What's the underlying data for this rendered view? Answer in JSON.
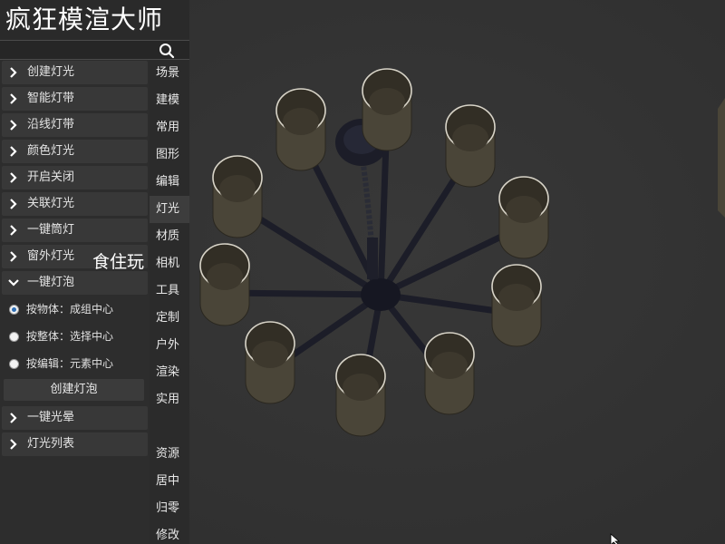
{
  "app": {
    "title": "疯狂模渲大师"
  },
  "search": {
    "icon": "search-icon"
  },
  "menu": {
    "items_top": [
      {
        "label": "创建灯光",
        "expanded": false
      },
      {
        "label": "智能灯带",
        "expanded": false
      },
      {
        "label": "沿线灯带",
        "expanded": false
      },
      {
        "label": "颜色灯光",
        "expanded": false
      },
      {
        "label": "开启关闭",
        "expanded": false
      },
      {
        "label": "关联灯光",
        "expanded": false
      },
      {
        "label": "一键筒灯",
        "expanded": false
      },
      {
        "label": "窗外灯光",
        "expanded": false
      },
      {
        "label": "一键灯泡",
        "expanded": true
      }
    ],
    "bulb_options": [
      {
        "label": "按物体：成组中心",
        "selected": true
      },
      {
        "label": "按整体：选择中心",
        "selected": false
      },
      {
        "label": "按编辑：元素中心",
        "selected": false
      }
    ],
    "create_bulb_button": "创建灯泡",
    "items_bottom": [
      {
        "label": "一键光晕",
        "expanded": false
      },
      {
        "label": "灯光列表",
        "expanded": false
      }
    ]
  },
  "tabs": {
    "items": [
      {
        "label": "场景",
        "active": false
      },
      {
        "label": "建模",
        "active": false
      },
      {
        "label": "常用",
        "active": false
      },
      {
        "label": "图形",
        "active": false
      },
      {
        "label": "编辑",
        "active": false
      },
      {
        "label": "灯光",
        "active": true
      },
      {
        "label": "材质",
        "active": false
      },
      {
        "label": "相机",
        "active": false
      },
      {
        "label": "工具",
        "active": false
      },
      {
        "label": "定制",
        "active": false
      },
      {
        "label": "户外",
        "active": false
      },
      {
        "label": "渲染",
        "active": false
      },
      {
        "label": "实用",
        "active": false
      },
      {
        "label": "",
        "active": false
      },
      {
        "label": "资源",
        "active": false
      },
      {
        "label": "居中",
        "active": false
      },
      {
        "label": "归零",
        "active": false
      },
      {
        "label": "修改",
        "active": false
      }
    ]
  },
  "overlay": {
    "watermark_text": "食住玩"
  },
  "colors": {
    "background": "#333333",
    "panel": "#2d2d2d",
    "menu_item": "#383838",
    "shade_fill": "#4a4538",
    "shade_rim": "#d8d4c8",
    "arm": "#1c1d28"
  }
}
